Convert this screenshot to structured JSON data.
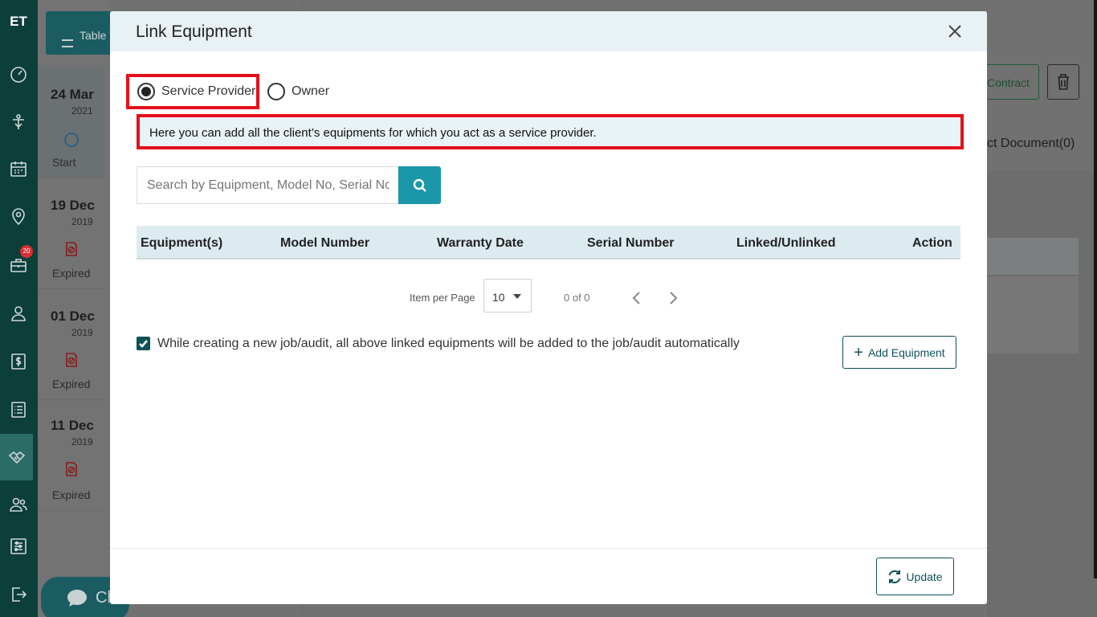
{
  "sidebar": {
    "logo": "ET",
    "badge_count": "20",
    "items": [
      {
        "name": "dashboard-icon"
      },
      {
        "name": "funnel-icon"
      },
      {
        "name": "calendar-icon"
      },
      {
        "name": "location-icon"
      },
      {
        "name": "briefcase-icon"
      },
      {
        "name": "user-icon"
      },
      {
        "name": "dollar-icon"
      },
      {
        "name": "list-icon"
      },
      {
        "name": "handshake-icon"
      },
      {
        "name": "users-icon"
      },
      {
        "name": "settings-sliders-icon"
      },
      {
        "name": "logout-icon"
      }
    ]
  },
  "background": {
    "table_view_label": "Table V",
    "dates": [
      {
        "day": "24 Mar",
        "year": "2021",
        "status": "Start"
      },
      {
        "day": "19 Dec",
        "year": "2019",
        "status": "Expired"
      },
      {
        "day": "01 Dec",
        "year": "2019",
        "status": "Expired"
      },
      {
        "day": "11 Dec",
        "year": "2019",
        "status": "Expired"
      }
    ],
    "contract_btn": "Contract",
    "doc_tab": "ct Document(0)",
    "chat_label": "Ch"
  },
  "modal": {
    "title": "Link Equipment",
    "radio": {
      "service_provider": "Service Provider",
      "owner": "Owner",
      "selected": "service_provider"
    },
    "info_text": "Here you can add all the client’s equipments for which you act as a service provider.",
    "search": {
      "placeholder": "Search by Equipment, Model No, Serial No.",
      "value": ""
    },
    "table": {
      "columns": [
        "Equipment(s)",
        "Model Number",
        "Warranty Date",
        "Serial Number",
        "Linked/Unlinked",
        "Action"
      ],
      "rows": []
    },
    "pagination": {
      "label": "Item per Page",
      "per_page": "10",
      "count": "0 of 0"
    },
    "auto_add": {
      "checked": true,
      "label": "While creating a new job/audit, all above linked equipments will be added to the job/audit automatically"
    },
    "add_equipment_label": "Add Equipment",
    "update_label": "Update"
  },
  "colors": {
    "sidebar_bg": "#0c3e3a",
    "accent": "#1a97a8",
    "primary": "#0f5157",
    "highlight_border": "#e3101c",
    "header_bg": "#e8f1f4"
  }
}
